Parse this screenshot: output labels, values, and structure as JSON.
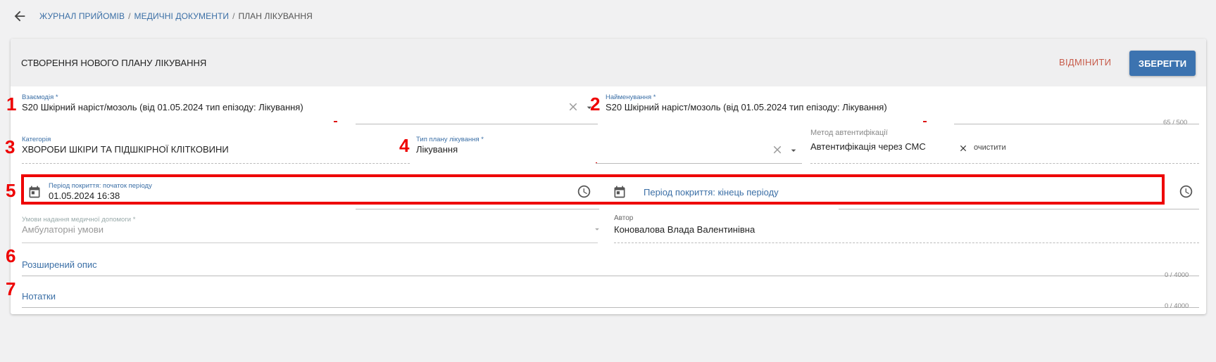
{
  "breadcrumb": {
    "items": [
      "ЖУРНАЛ ПРИЙОМІВ",
      "МЕДИЧНІ ДОКУМЕНТИ",
      "ПЛАН ЛІКУВАННЯ"
    ],
    "separator": "/"
  },
  "header": {
    "title": "СТВОРЕННЯ НОВОГО ПЛАНУ ЛІКУВАННЯ",
    "cancel_label": "ВІДМІНИТИ",
    "save_label": "ЗБЕРЕГТИ"
  },
  "fields": {
    "interaction": {
      "label": "Взаємодія *",
      "value": "S20 Шкірний наріст/мозоль (від 01.05.2024 тип епізоду: Лікування)"
    },
    "name": {
      "label": "Найменування *",
      "value": "S20 Шкірний наріст/мозоль (від 01.05.2024 тип епізоду: Лікування)",
      "counter": "65 / 500"
    },
    "category": {
      "label": "Категорія",
      "value": "ХВОРОБИ ШКІРИ ТА ПІДШКІРНОЇ КЛІТКОВИНИ"
    },
    "plan_type": {
      "label": "Тип плану лікування *",
      "value": "Лікування"
    },
    "auth_method": {
      "label": "Метод автентифікації",
      "value": "Автентифікація через СМС",
      "clear_label": "очистити"
    },
    "period_start": {
      "label": "Період покриття: початок періоду",
      "value": "01.05.2024 16:38"
    },
    "period_end": {
      "placeholder": "Період покриття: кінець періоду"
    },
    "care_conditions": {
      "label": "Умови надання медичної допомоги *",
      "value": "Амбулаторні умови"
    },
    "author": {
      "label": "Автор",
      "value": "Коновалова Влада Валентинівна"
    },
    "extended_description": {
      "placeholder": "Розширений опис",
      "counter": "0 / 4000"
    },
    "notes": {
      "placeholder": "Нотатки",
      "counter": "0 / 4000"
    }
  },
  "annotations": [
    "1",
    "2",
    "3",
    "4",
    "5",
    "6",
    "7"
  ],
  "colors": {
    "accent": "#3c73b0",
    "link": "#3b6fa6",
    "cancel": "#c75b4a",
    "annotation": "#ee0000"
  },
  "icons": [
    "arrow-left-icon",
    "close-icon",
    "chevron-down-icon",
    "calendar-icon",
    "clock-icon"
  ]
}
